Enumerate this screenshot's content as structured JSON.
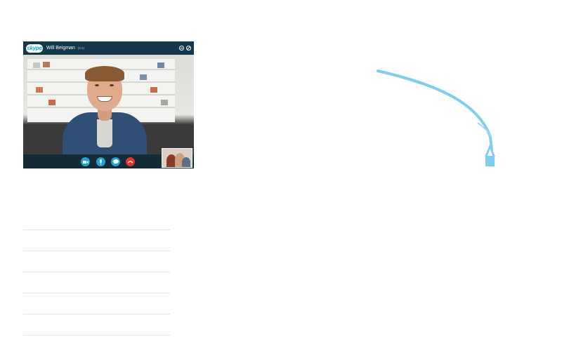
{
  "call": {
    "logo_text": "skype",
    "caller_name": "Will Beigman",
    "call_time": "(6:4)",
    "title_icons": [
      "minimize-icon",
      "close-icon"
    ],
    "controls": [
      {
        "name": "video-button",
        "icon": "video-camera-icon",
        "color": "#1aa3e0"
      },
      {
        "name": "mute-button",
        "icon": "microphone-icon",
        "color": "#1aa3e0"
      },
      {
        "name": "chat-button",
        "icon": "chat-bubble-icon",
        "color": "#1aa3e0"
      },
      {
        "name": "end-call-button",
        "icon": "hang-up-icon",
        "color": "#e5322f"
      }
    ]
  },
  "colors": {
    "skype_blue": "#00aff0",
    "arrow": "#7ccfee",
    "title_bar": "#14384a"
  }
}
